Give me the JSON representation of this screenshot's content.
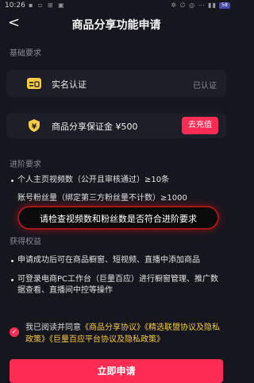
{
  "status_bar": {
    "time": "10:26",
    "left_icons": "▪ ▫ ⊞ ▣",
    "right_icons": "✲ ∅ ◎ ⋯ ▮▮",
    "battery": "58"
  },
  "header": {
    "back_icon": "chevron-left",
    "back_glyph": "<",
    "title": "商品分享功能申请"
  },
  "basic": {
    "label": "基础要求",
    "realname": {
      "icon": "id-card-icon",
      "text": "实名认证",
      "status": "已认证"
    },
    "deposit": {
      "icon": "yen-shield-icon",
      "text": "商品分享保证金 ¥500",
      "button": "去充值"
    }
  },
  "advanced": {
    "label": "进阶要求",
    "items": [
      "个人主页视频数（公开且审核通过）≥10条",
      "账号粉丝量（绑定第三方粉丝量不计数）≥1000"
    ]
  },
  "overlay": {
    "text": "请检查视频数和粉丝数是否符合进阶要求"
  },
  "benefits": {
    "label": "获得权益",
    "items": [
      "申请成功后可在商品橱窗、短视频、直播中添加商品",
      "可登录电商PC工作台（巨量百应）进行橱窗管理、推广数据查看、直播间中控等操作"
    ]
  },
  "agreement": {
    "prefix": "我已阅读并同意",
    "link1": "《商品分享协议》",
    "link2": "《精选联盟协议及隐私政策》",
    "link3": "《巨量百应平台协议及隐私政策》"
  },
  "apply_button": "立即申请",
  "colors": {
    "accent": "#fe2c55",
    "gold": "#f7c948",
    "background": "#16161f"
  }
}
